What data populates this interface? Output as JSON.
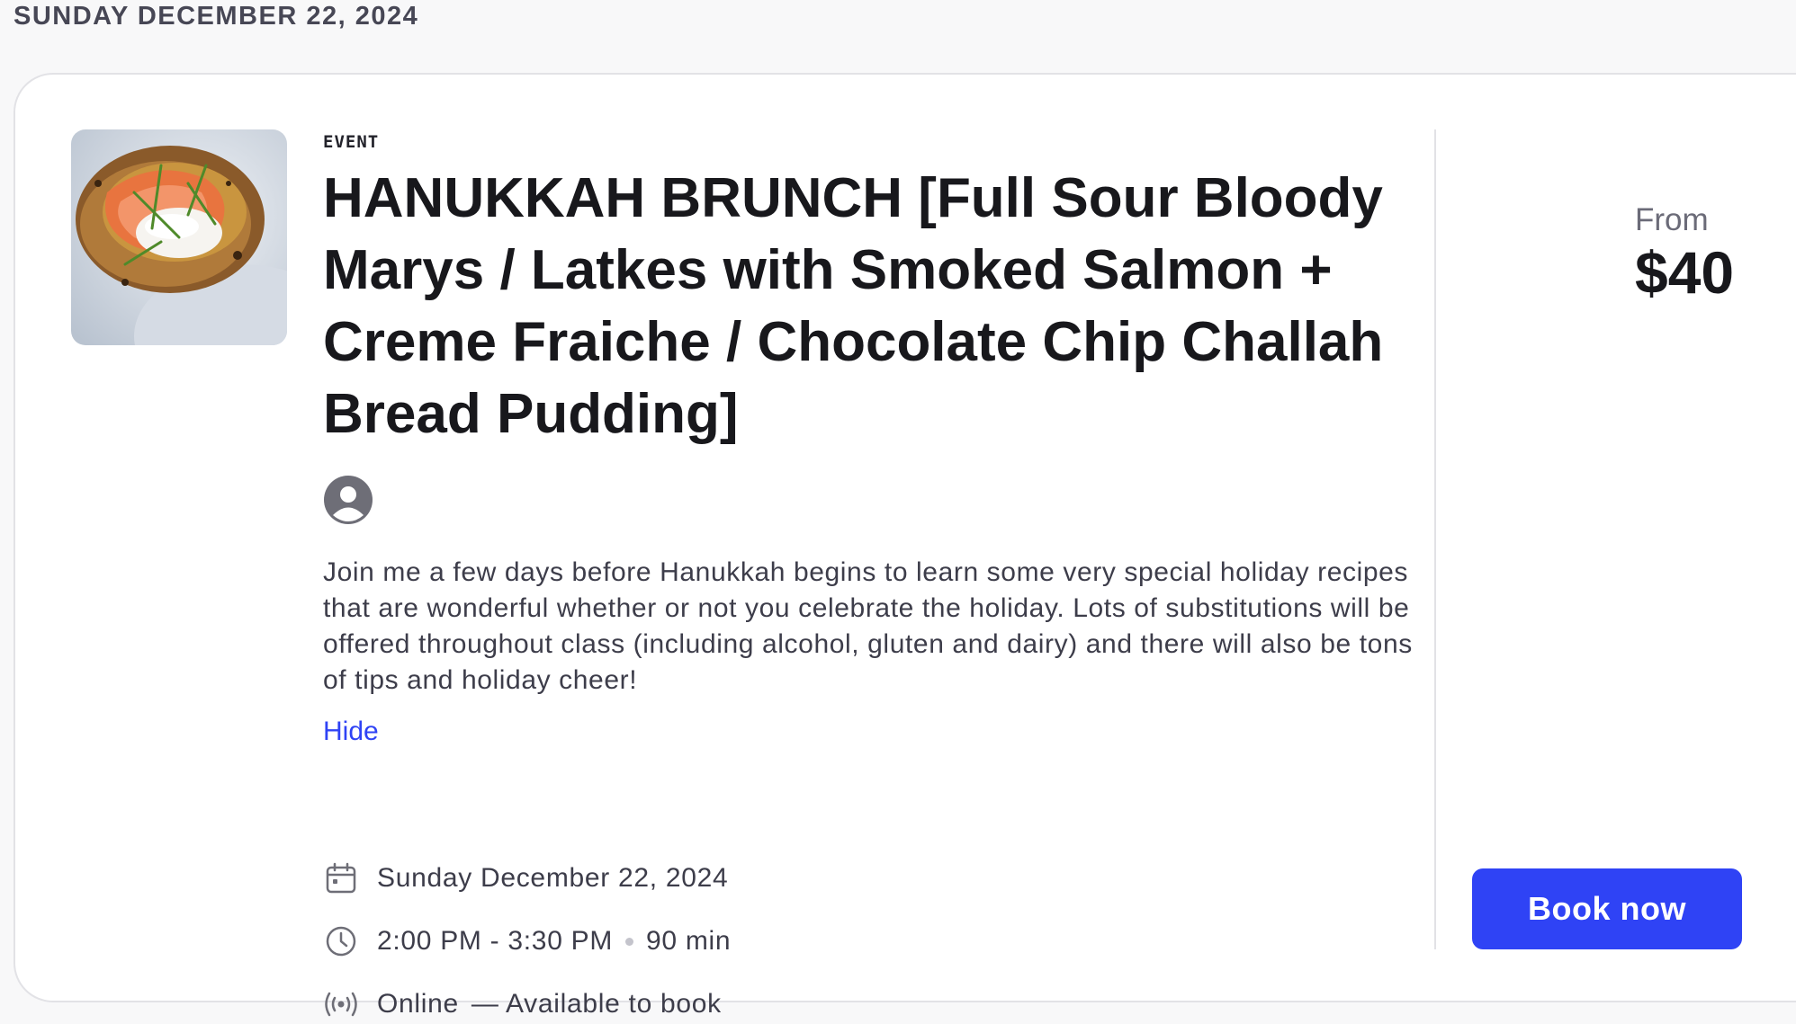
{
  "date_header": "SUNDAY DECEMBER 22, 2024",
  "event": {
    "eyebrow": "EVENT",
    "title": "HANUKKAH BRUNCH [Full Sour Bloody Marys / Latkes with Smoked Salmon + Creme Fraiche / Chocolate Chip Challah Bread Pudding]",
    "description": "Join me a few days before Hanukkah begins to learn some very special holiday recipes that are wonderful whether or not you celebrate the holiday. Lots of substitutions will be offered throughout class (including alcohol, gluten and dairy) and there will also be tons of tips and holiday cheer!",
    "hide_label": "Hide",
    "date": "Sunday December 22, 2024",
    "time_range": "2:00 PM - 3:30 PM",
    "duration": "90 min",
    "location": "Online",
    "availability": "— Available to book"
  },
  "pricing": {
    "from_label": "From",
    "price": "$40"
  },
  "actions": {
    "book_label": "Book now"
  },
  "icons": {
    "avatar": "user-avatar-icon",
    "date": "calendar-icon",
    "time": "clock-icon",
    "location": "broadcast-icon"
  },
  "colors": {
    "accent": "#2f43f5",
    "text": "#18181c",
    "muted": "#3d3d4a",
    "border": "#e2e2e6",
    "background": "#f8f8f9"
  }
}
